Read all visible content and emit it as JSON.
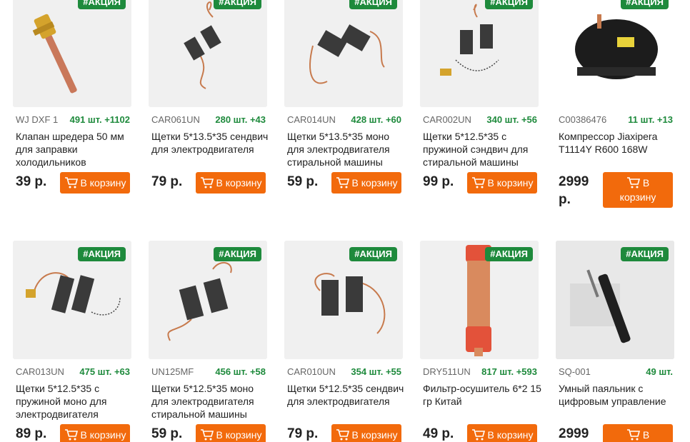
{
  "badge_label": "#АКЦИЯ",
  "cart_label": "В корзину",
  "cart_label_line1": "В",
  "cart_label_line2": "корзину",
  "colors": {
    "accent_green": "#1e8a3c",
    "button_orange": "#f26a0c"
  },
  "products": [
    {
      "sku": "WJ DXF 1",
      "stock": "491 шт. +1102",
      "name": "Клапан шредера 50 мм для заправки холодильников",
      "price": "39 р.",
      "image": "schrader-valve"
    },
    {
      "sku": "CAR061UN",
      "stock": "280 шт. +43",
      "name": "Щетки 5*13.5*35 сендвич для электродвигателя",
      "price": "79 р.",
      "image": "motor-brushes"
    },
    {
      "sku": "CAR014UN",
      "stock": "428 шт. +60",
      "name": "Щетки 5*13.5*35 моно для электродвигателя стиральной машины",
      "price": "59 р.",
      "image": "motor-brushes"
    },
    {
      "sku": "CAR002UN",
      "stock": "340 шт. +56",
      "name": "Щетки 5*12.5*35 с пружиной сэндвич для стиральной машины",
      "price": "99 р.",
      "image": "motor-brushes-spring"
    },
    {
      "sku": "C00386476",
      "stock": "11 шт. +13",
      "name": "Компрессор Jiaxipera T1114Y R600 168W",
      "price": "2999 р.",
      "image": "compressor"
    },
    {
      "sku": "CAR013UN",
      "stock": "475 шт. +63",
      "name": "Щетки 5*12.5*35 с пружиной моно для электродвигателя",
      "price": "89 р.",
      "image": "motor-brushes-spring"
    },
    {
      "sku": "UN125MF",
      "stock": "456 шт. +58",
      "name": "Щетки 5*12.5*35 моно для электродвигателя стиральной машины",
      "price": "59 р.",
      "image": "motor-brushes"
    },
    {
      "sku": "CAR010UN",
      "stock": "354 шт. +55",
      "name": "Щетки 5*12.5*35 сендвич для электродвигателя",
      "price": "79 р.",
      "image": "motor-brushes"
    },
    {
      "sku": "DRY511UN",
      "stock": "817 шт. +593",
      "name": "Фильтр-осушитель 6*2 15 гр Китай",
      "price": "49 р.",
      "image": "filter-drier"
    },
    {
      "sku": "SQ-001",
      "stock": "49 шт.",
      "name": "Умный паяльник с цифровым управление",
      "price": "2999",
      "image": "soldering-iron"
    }
  ]
}
